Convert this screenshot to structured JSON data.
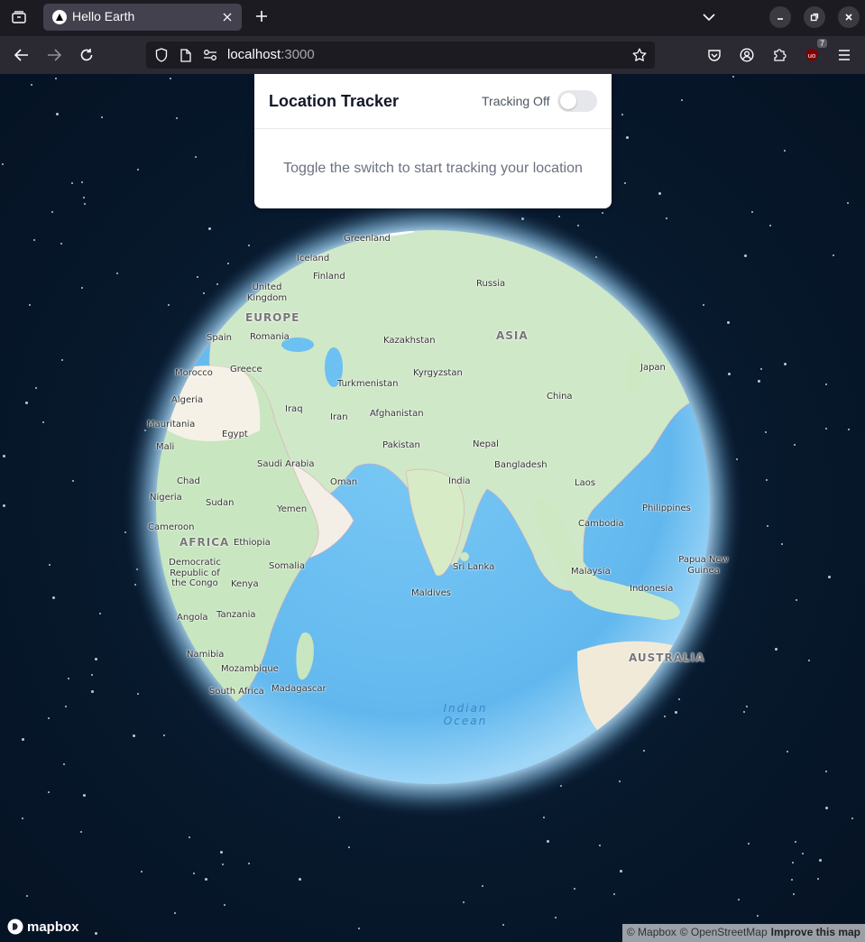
{
  "browser": {
    "tab_title": "Hello Earth",
    "url_host": "localhost",
    "url_port": ":3000",
    "extension_badge": "7"
  },
  "panel": {
    "title": "Location Tracker",
    "tracking_status": "Tracking Off",
    "tracking_enabled": false,
    "message": "Toggle the switch to start tracking your location"
  },
  "map": {
    "labels": [
      "Greenland",
      "Iceland",
      "Finland",
      "Russia",
      "United Kingdom",
      "EUROPE",
      "Spain",
      "Romania",
      "Kazakhstan",
      "ASIA",
      "Morocco",
      "Greece",
      "Kyrgyzstan",
      "Japan",
      "Turkmenistan",
      "Algeria",
      "China",
      "Iraq",
      "Afghanistan",
      "Mauritania",
      "Iran",
      "Egypt",
      "Pakistan",
      "Mali",
      "Nepal",
      "Saudi Arabia",
      "Bangladesh",
      "Chad",
      "Oman",
      "India",
      "Laos",
      "Nigeria",
      "Sudan",
      "Philippines",
      "Yemen",
      "Cameroon",
      "Cambodia",
      "AFRICA",
      "Ethiopia",
      "Papua New Guinea",
      "Democratic Republic of the Congo",
      "Somalia",
      "Sri Lanka",
      "Malaysia",
      "Kenya",
      "Indonesia",
      "Maldives",
      "Angola",
      "Tanzania",
      "Namibia",
      "AUSTRALIA",
      "Mozambique",
      "Madagascar",
      "South Africa",
      "Indian Ocean"
    ],
    "logo_text": "mapbox",
    "attribution_mapbox": "© Mapbox",
    "attribution_osm": "© OpenStreetMap",
    "improve_link": "Improve this map"
  },
  "colors": {
    "space": "#071a2e",
    "ocean": "#6cc0f2",
    "land": "#c8e6c0",
    "panel_bg": "#ffffff"
  }
}
